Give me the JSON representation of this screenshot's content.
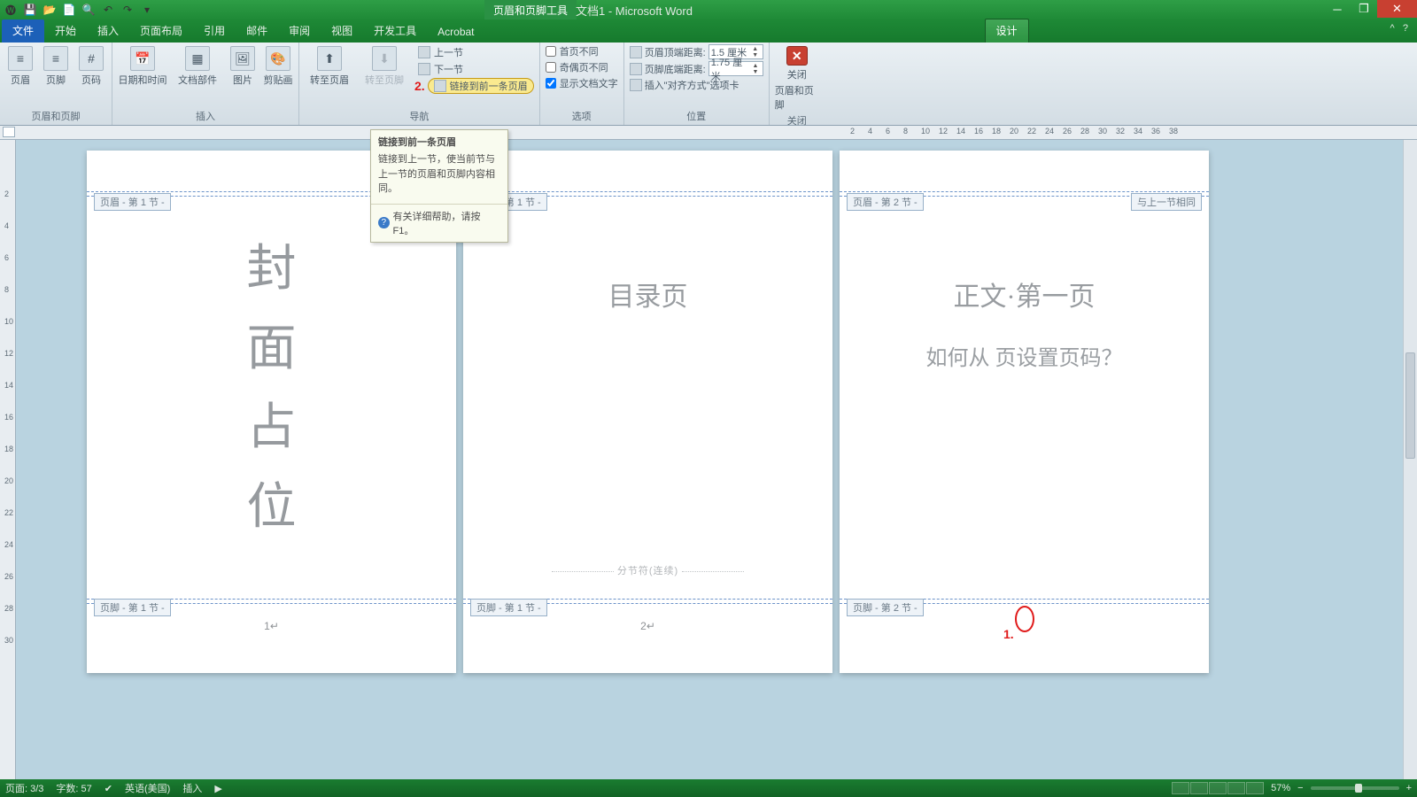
{
  "titlebar": {
    "context_tools": "页眉和页脚工具",
    "doc_title": "文档1 - Microsoft Word"
  },
  "tabs": {
    "file": "文件",
    "home": "开始",
    "insert": "插入",
    "layout": "页面布局",
    "references": "引用",
    "mailings": "邮件",
    "review": "审阅",
    "view": "视图",
    "developer": "开发工具",
    "acrobat": "Acrobat",
    "design": "设计"
  },
  "ribbon": {
    "group1": {
      "header": "页眉",
      "footer": "页脚",
      "page_number": "页码",
      "label": "页眉和页脚"
    },
    "group2": {
      "datetime": "日期和时间",
      "docparts": "文档部件",
      "picture": "图片",
      "clipart": "剪贴画",
      "label": "插入"
    },
    "group3": {
      "goto_header": "转至页眉",
      "goto_footer": "转至页脚",
      "prev": "上一节",
      "next": "下一节",
      "link_prev": "链接到前一条页眉",
      "label": "导航"
    },
    "group4": {
      "diff_first": "首页不同",
      "diff_oddeven": "奇偶页不同",
      "show_text": "显示文档文字",
      "label": "选项"
    },
    "group5": {
      "hdr_dist_label": "页眉顶端距离:",
      "hdr_dist_val": "1.5 厘米",
      "ftr_dist_label": "页脚底端距离:",
      "ftr_dist_val": "1.75 厘米",
      "align_tab": "插入\"对齐方式\"选项卡",
      "label": "位置"
    },
    "group6": {
      "close1": "关闭",
      "close2": "页眉和页脚",
      "label": "关闭"
    }
  },
  "tooltip": {
    "title": "链接到前一条页眉",
    "body": "链接到上一节，使当前节与上一节的页眉和页脚内容相同。",
    "help": "有关详细帮助，请按 F1。"
  },
  "annotations": {
    "a2": "2.",
    "a1": "1."
  },
  "pages": {
    "p1": {
      "hdr_tag": "页眉 - 第 1 节 -",
      "ftr_tag": "页脚 - 第 1 节 -",
      "c1": "封",
      "c2": "面",
      "c3": "占",
      "c4": "位",
      "num": "1"
    },
    "p2": {
      "hdr_tag": "页眉 - 第 1 节 -",
      "ftr_tag": "页脚 - 第 1 节 -",
      "title": "目录页",
      "break": "分节符(连续)",
      "num": "2"
    },
    "p3": {
      "hdr_tag": "页眉 - 第 2 节 -",
      "ftr_tag": "页脚 - 第 2 节 -",
      "same_tag": "与上一节相同",
      "title": "正文·第一页",
      "subtitle": "如何从 页设置页码？"
    }
  },
  "statusbar": {
    "page": "页面: 3/3",
    "words": "字数: 57",
    "lang": "英语(美国)",
    "mode": "插入",
    "zoom": "57%"
  },
  "ruler_h": [
    "2",
    "4",
    "6",
    "8",
    "10",
    "12",
    "14",
    "16",
    "18",
    "20",
    "22",
    "24",
    "26",
    "28",
    "30",
    "32",
    "34",
    "36",
    "38"
  ]
}
